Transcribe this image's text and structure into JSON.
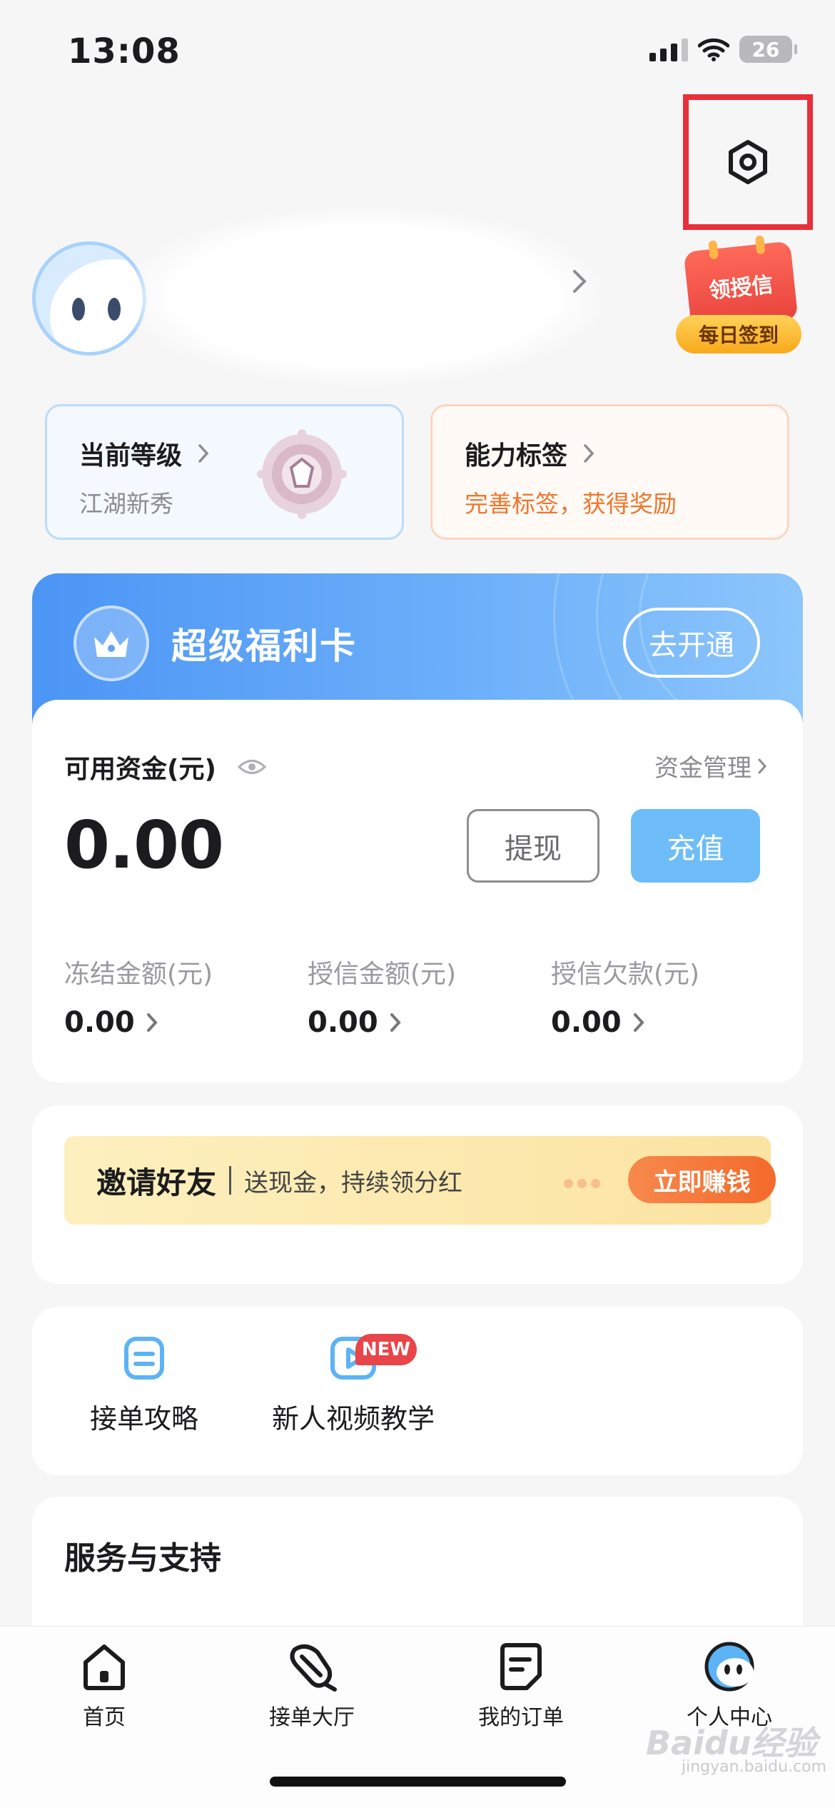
{
  "status_bar": {
    "time": "13:08",
    "battery": "26"
  },
  "profile": {
    "settings_icon": "settings-hexagon-icon",
    "signin": {
      "badge": "领授信",
      "pill": "每日签到"
    }
  },
  "level_card": {
    "title": "当前等级",
    "subtitle": "江湖新秀"
  },
  "tags_card": {
    "title": "能力标签",
    "subtitle": "完善标签，获得奖励"
  },
  "welfare": {
    "title": "超级福利卡",
    "button": "去开通"
  },
  "funds": {
    "label": "可用资金(元)",
    "manage": "资金管理",
    "amount": "0.00",
    "withdraw": "提现",
    "recharge": "充值",
    "items": [
      {
        "label": "冻结金额(元)",
        "value": "0.00"
      },
      {
        "label": "授信金额(元)",
        "value": "0.00"
      },
      {
        "label": "授信欠款(元)",
        "value": "0.00"
      }
    ]
  },
  "invite": {
    "title": "邀请好友",
    "subtitle": "送现金，持续领分红",
    "button": "立即赚钱"
  },
  "tools": [
    {
      "label": "接单攻略",
      "icon": "guide-doc-icon"
    },
    {
      "label": "新人视频教学",
      "icon": "video-play-icon",
      "badge": "NEW"
    }
  ],
  "service": {
    "title": "服务与支持"
  },
  "tabbar": [
    {
      "label": "首页",
      "icon": "home-icon"
    },
    {
      "label": "接单大厅",
      "icon": "order-hall-icon"
    },
    {
      "label": "我的订单",
      "icon": "my-orders-icon"
    },
    {
      "label": "个人中心",
      "icon": "profile-center-icon"
    }
  ],
  "watermark": {
    "logo": "Baidu经验",
    "url": "jingyan.baidu.com"
  },
  "colors": {
    "accent_blue": "#6ebdf8",
    "accent_orange": "#f36a2c",
    "highlight_red": "#e8303a"
  }
}
